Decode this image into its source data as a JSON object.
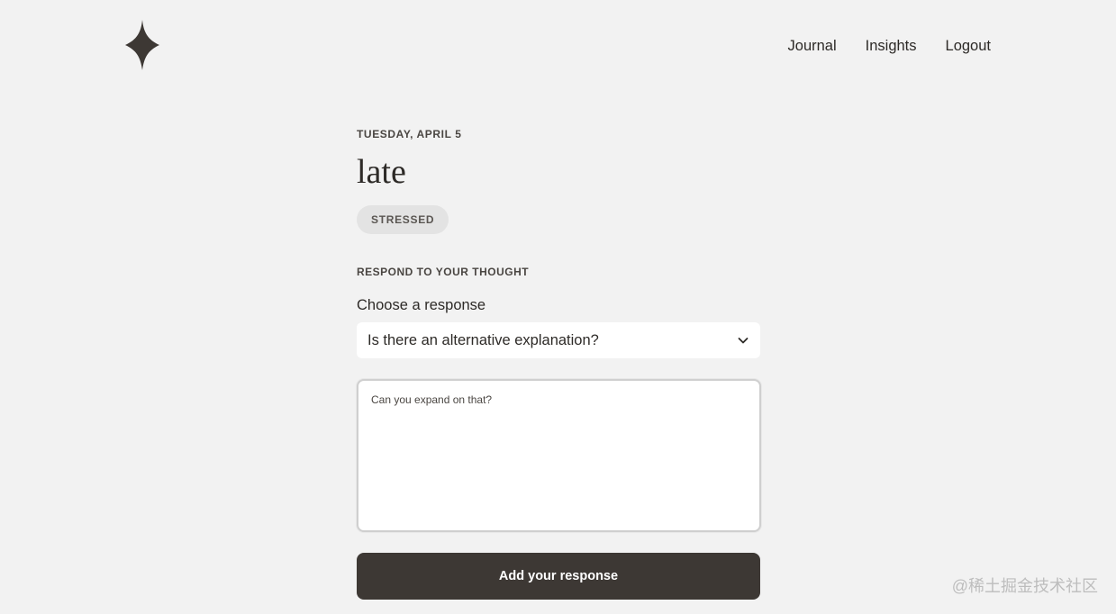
{
  "nav": {
    "items": [
      "Journal",
      "Insights",
      "Logout"
    ]
  },
  "entry": {
    "date": "TUESDAY, APRIL 5",
    "title": "late",
    "mood": "STRESSED"
  },
  "respond": {
    "section_label": "RESPOND TO YOUR THOUGHT",
    "choose_label": "Choose a response",
    "selected_response": "Is there an alternative explanation?",
    "textarea_placeholder": "Can you expand on that?",
    "submit_label": "Add your response"
  },
  "watermark": "@稀土掘金技术社区",
  "colors": {
    "background": "#f2f2f2",
    "primary_button": "#3d3834",
    "text": "#2d2a27",
    "badge_bg": "#e3e3e3"
  },
  "icons": {
    "logo": "four-point-star-icon",
    "select": "chevron-down-icon"
  }
}
